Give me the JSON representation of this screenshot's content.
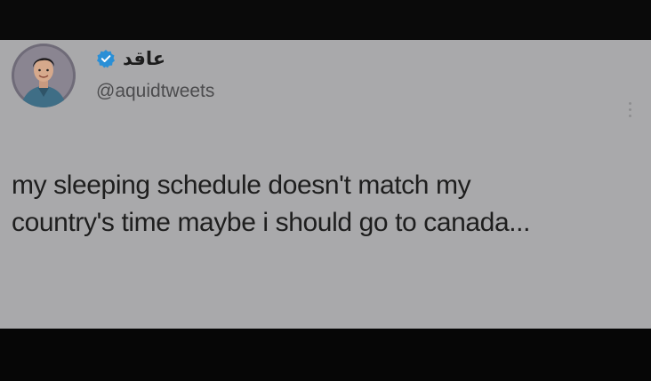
{
  "tweet": {
    "author": {
      "display_name": "عاقد",
      "handle": "@aquidtweets",
      "verified": true,
      "avatar_icon": "profile-photo"
    },
    "text_lines": [
      "my sleeping schedule doesn't match my",
      "country's time maybe i should go to canada..."
    ],
    "more_icon": "more-options-icon"
  },
  "colors": {
    "card_background": "#a9a9ab",
    "frame_background": "#0c0c0c",
    "verified_badge": "#2a8fd6",
    "text": "#1e1e1e",
    "handle_text": "#4c4c4e"
  }
}
